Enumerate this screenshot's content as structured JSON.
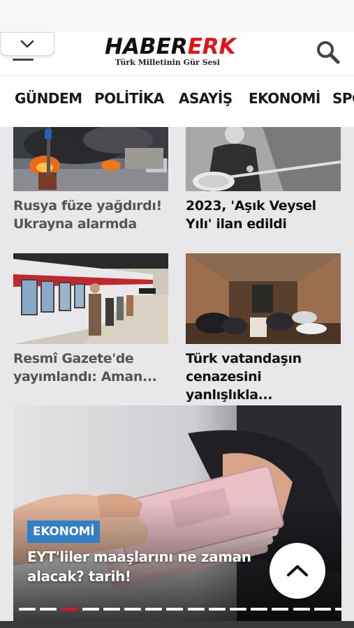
{
  "header": {
    "logo_part1": "HABER",
    "logo_part2": "ERK",
    "tagline": "Türk Milletinin Gür Sesi",
    "menu_icon": "chevron-down-icon",
    "search_icon": "search-icon",
    "accent_color": "#e0141c"
  },
  "nav": {
    "items": [
      "GÜNDEM",
      "POLİTİKA",
      "ASAYİŞ",
      "EKONOMİ",
      "SPOR"
    ]
  },
  "cards": [
    {
      "title": "Rusya füze yağdırdı! Ukrayna alarmda"
    },
    {
      "title": "2023, 'Aşık Veysel Yılı' ilan edildi"
    },
    {
      "title": "Resmî Gazete'de yayımlandı: Aman..."
    },
    {
      "title": "Türk vatandaşın cenazesini yanlışlıkla..."
    }
  ],
  "feature": {
    "category": "EKONOMİ",
    "title": "EYT'liler maaşlarını ne zaman alacak? tarih!",
    "slide_count": 16,
    "active_slide": 3,
    "badge_color": "#2f7fc9"
  },
  "scroll_top_icon": "chevron-up-icon"
}
